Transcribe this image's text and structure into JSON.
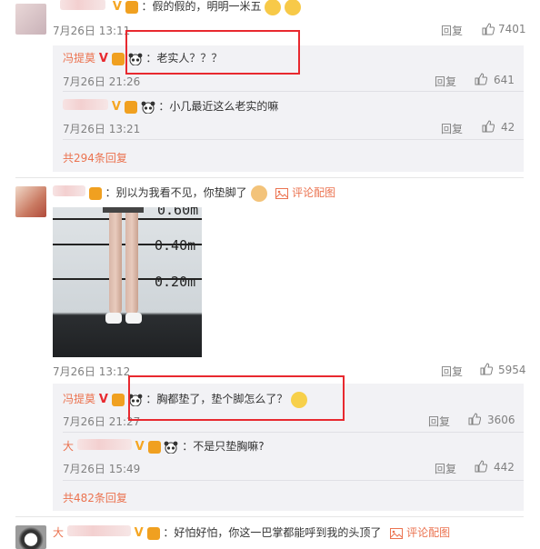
{
  "comments": [
    {
      "user": "",
      "text": "：假的假的，明明一米五",
      "time": "7月26日 13:11",
      "reply_label": "回复",
      "likes": "7401",
      "replies": [
        {
          "user": "冯提莫",
          "text": "：老实人？？？",
          "time": "7月26日 21:26",
          "reply_label": "回复",
          "likes": "641"
        },
        {
          "user": "",
          "text": "：小几最近这么老实的嘛",
          "time": "7月26日 13:21",
          "reply_label": "回复",
          "likes": "42"
        }
      ],
      "more": "共294条回复"
    },
    {
      "user": "",
      "text": "：别以为我看不见，你垫脚了",
      "comment_pic_label": "评论配图",
      "photo_labels": [
        "0.60m",
        "0.40m",
        "0.20m"
      ],
      "time": "7月26日 13:12",
      "reply_label": "回复",
      "likes": "5954",
      "replies": [
        {
          "user": "冯提莫",
          "text": "：胸都垫了，垫个脚怎么了？",
          "time": "7月26日 21:27",
          "reply_label": "回复",
          "likes": "3606"
        },
        {
          "user": "大",
          "text": "：不是只垫胸嘛?",
          "time": "7月26日 15:49",
          "reply_label": "回复",
          "likes": "442"
        }
      ],
      "more": "共482条回复"
    },
    {
      "user": "大",
      "text": "：好怕好怕，你这一巴掌都能呼到我的头顶了",
      "comment_pic_label": "评论配图"
    }
  ]
}
